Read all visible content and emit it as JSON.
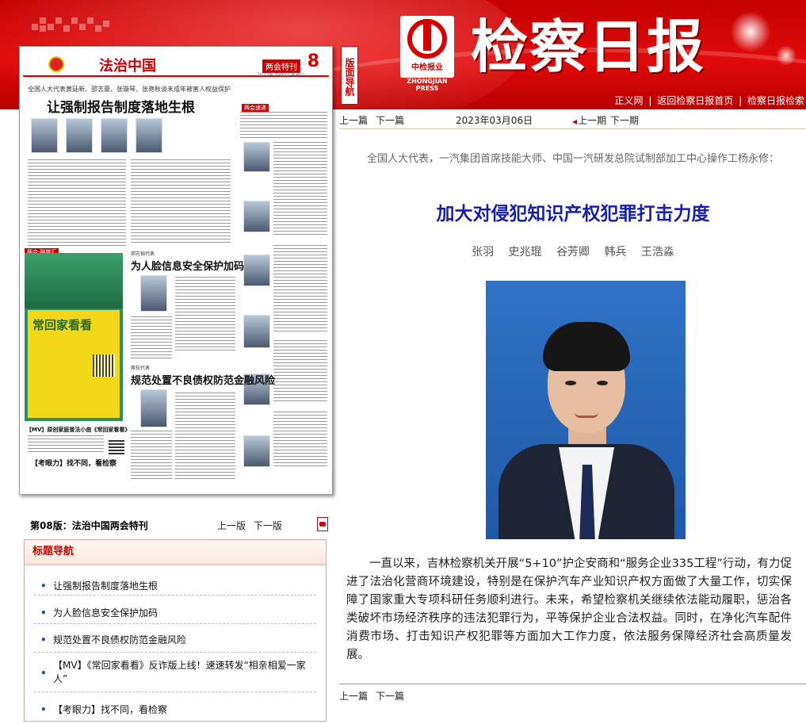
{
  "header": {
    "masthead": "检察日报",
    "logo_cn": "中检报业",
    "logo_en": "ZHONGJIAN PRESS",
    "side_tab": "版面导航",
    "links": [
      "正义网",
      "返回检察日报首页",
      "检察日报检索"
    ],
    "separator": "|"
  },
  "thumbnail": {
    "brand": "法治中国",
    "special": "两会特刊",
    "page_number": "8",
    "date": "2023年3月6日 星期一",
    "kicker": "全国人大代表黄廷新、邵志豪、张璇琴、张艳秋谈未成年被害人权益保护",
    "headline": "让强制报告制度落地生根",
    "sub1": "为人脸信息安全保护加码",
    "sub2": "规范处置不良债权防范金融风险",
    "mv_title": "常回家看看",
    "mv_caption": "【MV】原创家庭普法小曲《常回家看看》",
    "watch": "【考眼力】找不同，看检察",
    "tag": "两会·融媒汇",
    "tag2": "两会速递",
    "writer1": "廖志韬代表",
    "writer2": "蒋桂代表"
  },
  "edition": {
    "label": "第08版：法治中国两会特刊",
    "prev": "上一版",
    "next": "下一版"
  },
  "nav": {
    "title": "标题导航",
    "items": [
      "让强制报告制度落地生根",
      "为人脸信息安全保护加码",
      "规范处置不良债权防范金融风险",
      "【MV】《常回家看看》反诈版上线！速速转发“相亲相爱一家人”",
      "【考眼力】找不同，看检察"
    ]
  },
  "article": {
    "prev": "上一篇",
    "next": "下一篇",
    "date": "2023年03月06日",
    "prev_issue": "上一期",
    "next_issue": "下一期",
    "kicker": "全国人大代表，一汽集团首席技能大师、中国一汽研发总院试制部加工中心操作工杨永修：",
    "headline": "加大对侵犯知识产权犯罪打击力度",
    "authors": "张羽 史兆琨 谷芳卿 韩兵 王浩淼",
    "body": "一直以来，吉林检察机关开展“5+10”护企安商和“服务企业335工程”行动，有力促进了法治化营商环境建设，特别是在保护汽车产业知识产权方面做了大量工作，切实保障了国家重大专项科研任务顺利进行。未来，希望检察机关继续依法能动履职，惩治各类破坏市场经济秩序的违法犯罪行为，平等保护企业合法权益。同时，在净化汽车配件消费市场、打击知识产权犯罪等方面加大工作力度，依法服务保障经济社会高质量发展。"
  },
  "colors": {
    "header_red": "#d40000",
    "headline_blue": "#1520a8",
    "nav_title": "#c00000"
  }
}
